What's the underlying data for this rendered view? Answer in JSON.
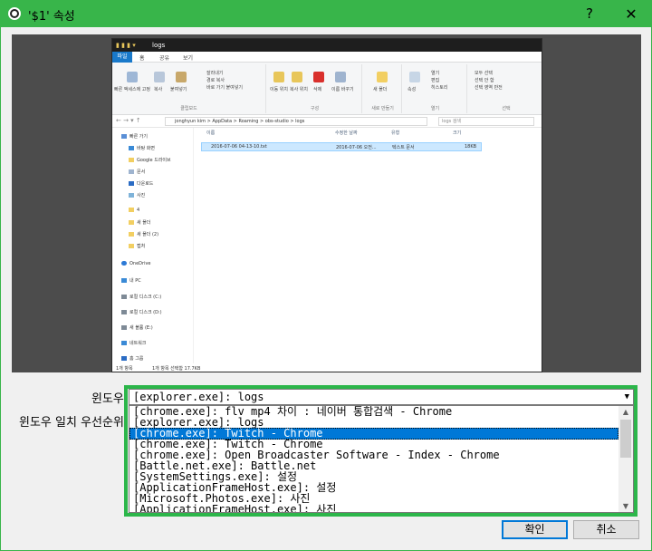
{
  "window": {
    "title": "'$1' 속성",
    "help": "?",
    "close": "✕"
  },
  "explorer": {
    "title_path": "logs",
    "quick_access": "▮ ▮ ▮ ▾",
    "tabs": {
      "file": "파일",
      "home": "홈",
      "share": "공유",
      "view": "보기"
    },
    "ribbon": {
      "pin": "빠른 액세스에 고정",
      "copy": "복사",
      "paste": "붙여넣기",
      "cut": "잘라내기",
      "copy_path": "경로 복사",
      "paste_shortcut": "바로 가기 붙여넣기",
      "clipboard": "클립보드",
      "move_to": "이동 위치",
      "copy_to": "복사 위치",
      "delete": "삭제",
      "rename": "이름 바꾸기",
      "organize": "구성",
      "new_folder": "새 폴더",
      "new": "새로 만들기",
      "properties": "속성",
      "open": "열기",
      "edit": "편집",
      "history": "히스토리",
      "open_group": "열기",
      "select_all": "모두 선택",
      "select_none": "선택 안 함",
      "invert": "선택 영역 반전",
      "select_group": "선택"
    },
    "address": {
      "nav": "← → ▾ ↑",
      "path": "jonghyun kim > AppData > Roaming > obs-studio > logs",
      "search": "logs 검색"
    },
    "nav_items": [
      "빠른 가기",
      "바탕 화면",
      "Google 드라이브",
      "문서",
      "다운로드",
      "사진",
      "4",
      "새 폴더",
      "새 폴더 (2)",
      "캡처",
      "OneDrive",
      "내 PC",
      "로컬 디스크 (C:)",
      "로컬 디스크 (D:)",
      "새 볼륨 (E:)",
      "네트워크",
      "홈 그룹"
    ],
    "columns": {
      "name": "이름",
      "modified": "수정한 날짜",
      "type": "유형",
      "size": "크기"
    },
    "file": {
      "name": "2016-07-06 04-13-10.txt",
      "modified": "2016-07-06 오전...",
      "type": "텍스트 문서",
      "size": "18KB"
    },
    "status": {
      "count": "1개 항목",
      "selected": "1개 항목 선택함 17.7KB"
    }
  },
  "form": {
    "window_label": "윈도우",
    "priority_label": "윈도우 일치 우선순위",
    "combo_value": "[explorer.exe]: logs",
    "combo_arrow": "▼",
    "options": [
      "[chrome.exe]: flv mp4 차이 : 네이버 통합검색 - Chrome",
      "[explorer.exe]: logs",
      "[chrome.exe]: Twitch - Chrome",
      "[chrome.exe]: Twitch - Chrome",
      "[chrome.exe]: Open Broadcaster Software - Index - Chrome",
      "[Battle.net.exe]: Battle.net",
      "[SystemSettings.exe]: 설정",
      "[ApplicationFrameHost.exe]: 설정",
      "[Microsoft.Photos.exe]: 사진",
      "[ApplicationFrameHost.exe]: 사진"
    ],
    "selected_index": 2,
    "scroll_up": "▲",
    "scroll_down": "▼"
  },
  "buttons": {
    "ok": "확인",
    "cancel": "취소"
  },
  "colors": {
    "title_bar": "#38b54a",
    "highlight_border": "#2cb64a",
    "selection": "#0078d7"
  }
}
